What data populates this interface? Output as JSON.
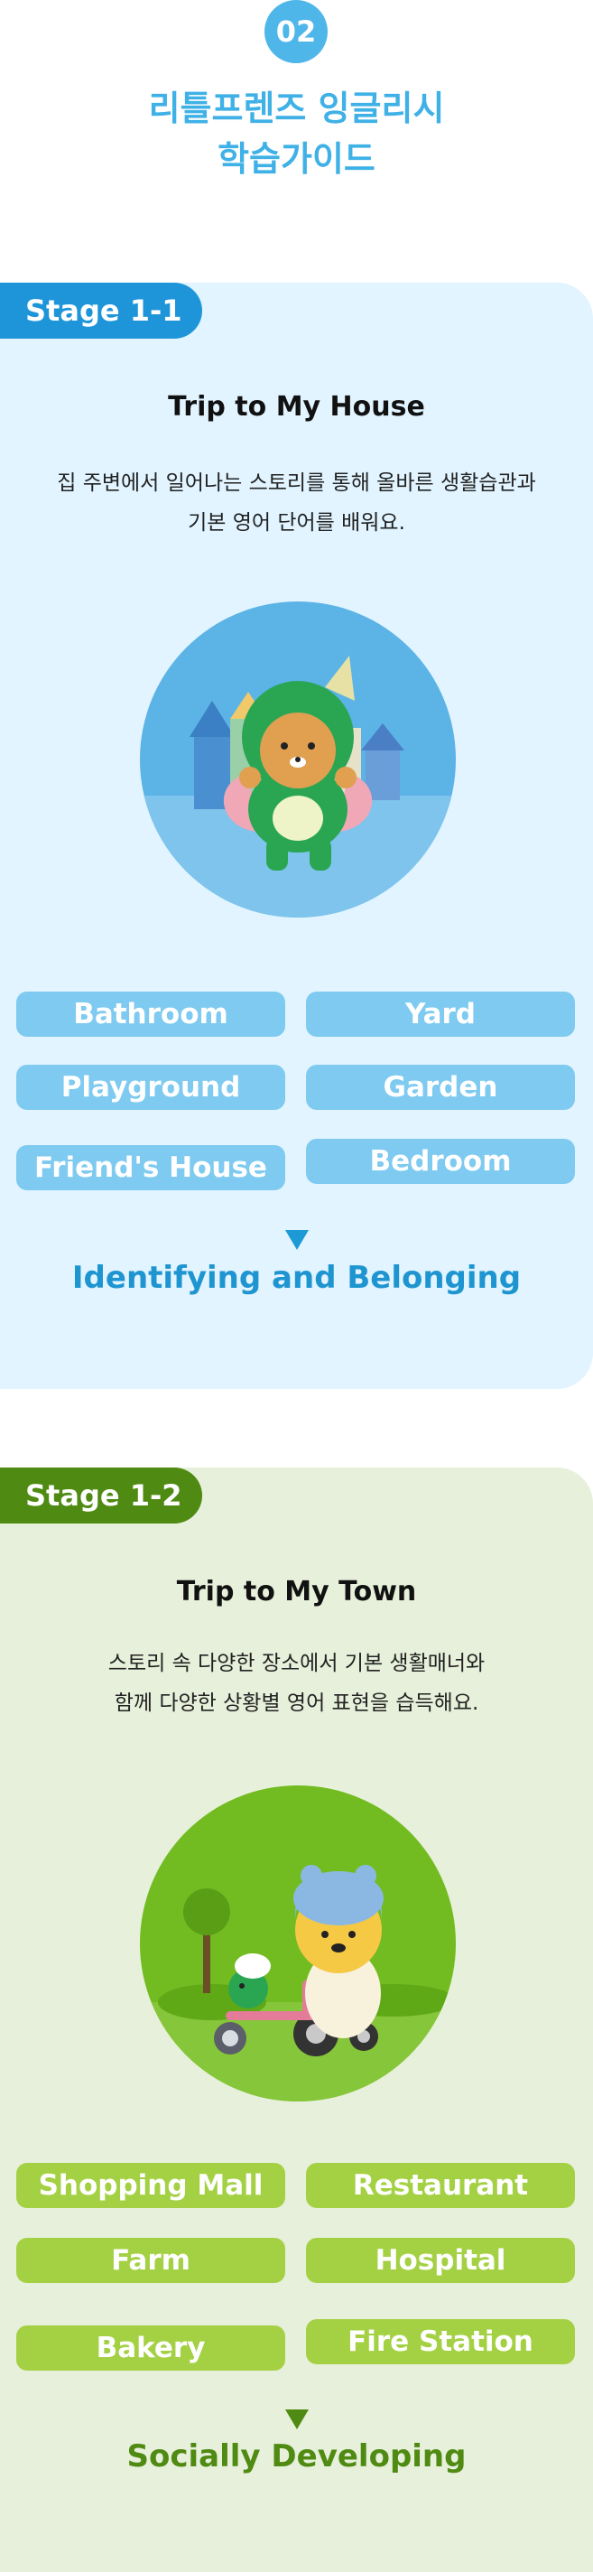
{
  "header": {
    "badge": "02",
    "title_line1": "리틀프렌즈 잉글리시",
    "title_line2": "학습가이드"
  },
  "stages": [
    {
      "tag": "Stage 1-1",
      "title": "Trip to My House",
      "desc_line1": "집 주변에서 일어나는 스토리를 통해 올바른 생활습관과",
      "desc_line2": "기본 영어 단어를 배워요.",
      "illustration": "dino-costume-bear-icon",
      "words": [
        "Bathroom",
        "Yard",
        "Playground",
        "Garden",
        "Friend's House",
        "Bedroom"
      ],
      "theme": "Identifying and Belonging",
      "colors": {
        "bg": "#e1f4ff",
        "tag": "#1e95d8",
        "pill": "#7ecaf0",
        "theme": "#1e95d0"
      }
    },
    {
      "tag": "Stage 1-2",
      "title": "Trip to My Town",
      "desc_line1": "스토리 속 다양한 장소에서 기본 생활매너와",
      "desc_line2": "함께 다양한 상황별 영어 표현을 습득해요.",
      "illustration": "tricycle-bear-icon",
      "words": [
        "Shopping Mall",
        "Restaurant",
        "Farm",
        "Hospital",
        "Bakery",
        "Fire Station"
      ],
      "theme": "Socially Developing",
      "colors": {
        "bg": "#e7f0da",
        "tag": "#4f8a12",
        "pill": "#a4d144",
        "theme": "#4f8a12"
      }
    }
  ]
}
